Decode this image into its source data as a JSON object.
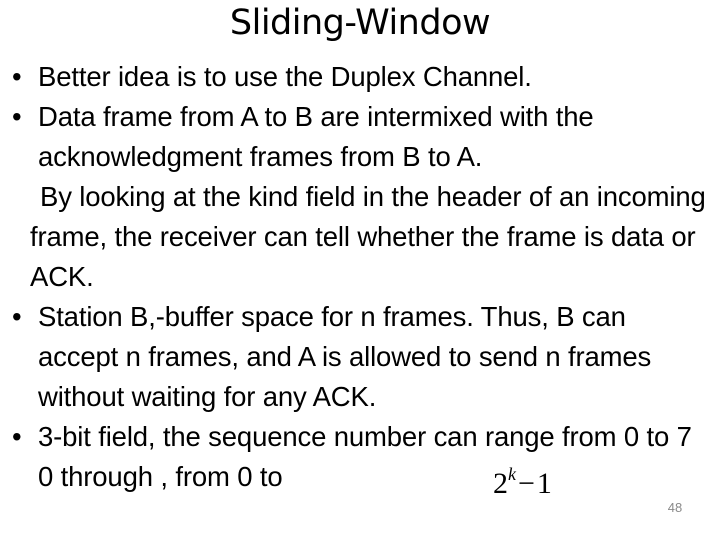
{
  "slide": {
    "title": "Sliding-Window",
    "background_color": "#ffffff",
    "text_color": "#000000",
    "page_number": "48",
    "page_number_color": "#8a8a8a",
    "bullet_glyph": "•"
  },
  "body": {
    "paragraphs": [
      {
        "bulleted": true,
        "text": "Better idea is to use the Duplex Channel."
      },
      {
        "bulleted": true,
        "text": "Data frame from A to B are intermixed with the acknowledgment frames from B to A."
      },
      {
        "bulleted": false,
        "text": "By looking at the kind field in the header of an incoming frame, the receiver can tell whether the frame is data or ACK."
      },
      {
        "bulleted": true,
        "text": "Station B,-buffer space for n frames. Thus, B can accept n frames, and A is allowed to send n frames without waiting for any ACK."
      },
      {
        "bulleted": true,
        "text": "3-bit field, the sequence number can range from 0 to 7 0 through , from 0 to"
      }
    ]
  },
  "equation": {
    "base": "2",
    "exponent": "k",
    "operator": "−",
    "operand": "1",
    "plain": "2^k − 1"
  }
}
